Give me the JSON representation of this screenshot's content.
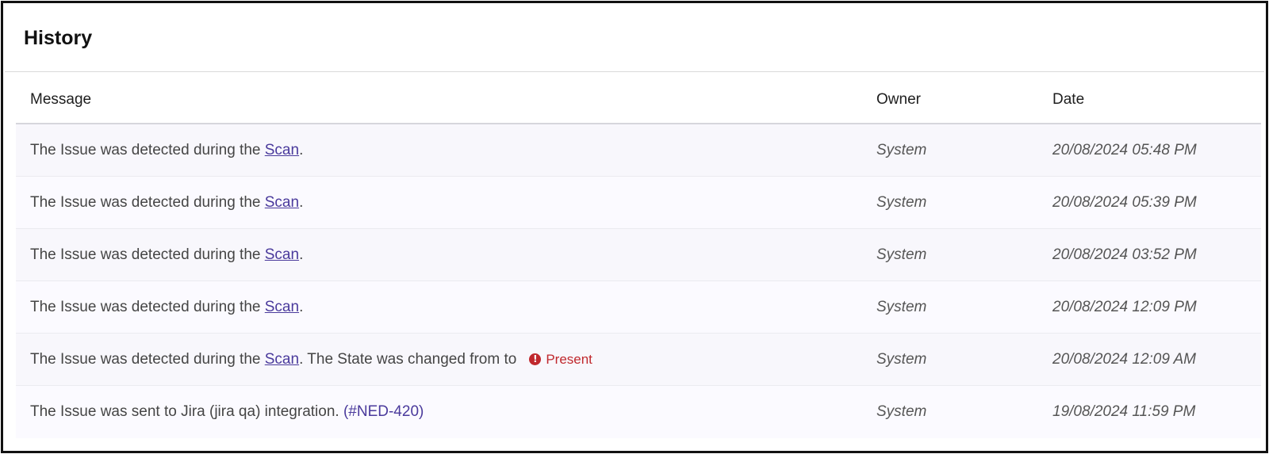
{
  "panel": {
    "title": "History"
  },
  "table": {
    "headers": {
      "message": "Message",
      "owner": "Owner",
      "date": "Date"
    },
    "rows": [
      {
        "prefix": "The Issue was detected during the ",
        "link": "Scan",
        "suffix": ".",
        "owner": "System",
        "date": "20/08/2024 05:48 PM"
      },
      {
        "prefix": "The Issue was detected during the ",
        "link": "Scan",
        "suffix": ".",
        "owner": "System",
        "date": "20/08/2024 05:39 PM"
      },
      {
        "prefix": "The Issue was detected during the ",
        "link": "Scan",
        "suffix": ".",
        "owner": "System",
        "date": "20/08/2024 03:52 PM"
      },
      {
        "prefix": "The Issue was detected during the ",
        "link": "Scan",
        "suffix": ".",
        "owner": "System",
        "date": "20/08/2024 12:09 PM"
      },
      {
        "prefix": "The Issue was detected during the ",
        "link": "Scan",
        "suffix": ". The State was changed from to",
        "state_icon": "!",
        "state": "Present",
        "owner": "System",
        "date": "20/08/2024 12:09 AM"
      },
      {
        "prefix": "The Issue was sent to Jira (jira qa) integration. ",
        "ticket": "(#NED-420)",
        "owner": "System",
        "date": "19/08/2024 11:59 PM"
      }
    ]
  },
  "colors": {
    "link": "#4a3a9c",
    "state_present": "#c0282d"
  },
  "icons": {
    "state_present": "exclamation-circle-icon"
  }
}
